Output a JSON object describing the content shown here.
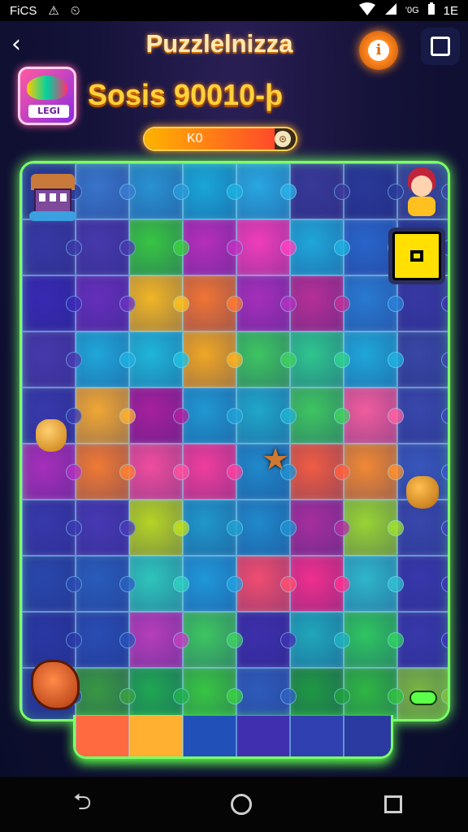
{
  "status_bar": {
    "left_text": "FiCS",
    "alert_glyph": "⚠",
    "clock_glyph": "⏲",
    "network_label": "'0G",
    "right_text": "1E"
  },
  "header": {
    "back_glyph": "‹",
    "title": "Puzzlelnizza",
    "info_glyph": "i"
  },
  "level": {
    "badge_text": "LEGI",
    "score_title": "Sosis 90010-þ"
  },
  "progress": {
    "label": "K0",
    "knob_glyph": "⊙",
    "fraction": 0.86
  },
  "icons": {
    "star_glyph": "★"
  },
  "nav": {
    "back_glyph": "⮌"
  },
  "colors": {
    "board_border": "#7cff6a",
    "title_gold": "#ffd23a",
    "accent_orange": "#ff8a20",
    "stop_yellow": "#ffe000"
  }
}
